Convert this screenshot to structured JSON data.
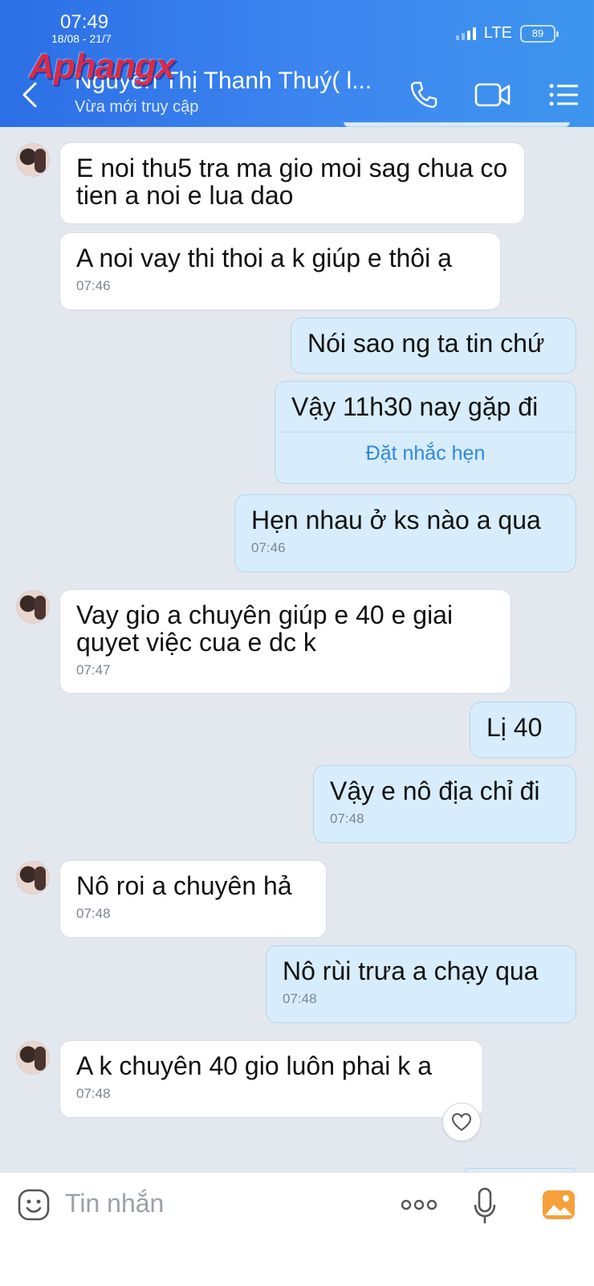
{
  "status_bar": {
    "time": "07:49",
    "date": "18/08 - 21/7",
    "network": "LTE",
    "battery": "89"
  },
  "header": {
    "watermark": "Aphangx",
    "contact_name": "Nguyễn Thị Thanh Thuý( l...",
    "contact_status": "Vừa mới truy cập"
  },
  "messages": [
    {
      "side": "in",
      "text": "E noi thu5 tra ma gio moi sag chua co tien a noi e lua dao",
      "time": ""
    },
    {
      "side": "in",
      "text": "A noi vay thi thoi a k giúp e thôi ạ",
      "time": "07:46"
    },
    {
      "side": "out",
      "text": "Nói sao ng ta tin chứ",
      "time": ""
    },
    {
      "side": "out",
      "text": "Vậy 11h30 nay gặp đi",
      "time": "",
      "action": "Đặt nhắc hẹn"
    },
    {
      "side": "out",
      "text": "Hẹn nhau ở ks nào a qua",
      "time": "07:46"
    },
    {
      "side": "in",
      "text": "Vay gio a chuyên giúp e 40 e giai quyet việc cua e dc k",
      "time": "07:47"
    },
    {
      "side": "out",
      "text": "Lị 40",
      "time": ""
    },
    {
      "side": "out",
      "text": "Vậy e nô địa chỉ đi",
      "time": "07:48"
    },
    {
      "side": "in",
      "text": "Nô roi a chuyên hả",
      "time": "07:48"
    },
    {
      "side": "out",
      "text": "Nô rùi trưa a chạy qua",
      "time": "07:48"
    },
    {
      "side": "in",
      "text": "A k chuyên 40  gio luôn phai k a",
      "time": "07:48"
    }
  ],
  "input_bar": {
    "placeholder": "Tin nhắn"
  },
  "icons": {
    "back": "chevron-left-icon",
    "call": "phone-icon",
    "video": "video-camera-icon",
    "menu": "list-menu-icon",
    "sticker": "smiley-icon",
    "more": "ellipsis-icon",
    "voice": "microphone-icon",
    "gallery": "image-icon",
    "react": "heart-icon"
  },
  "colors": {
    "header_start": "#2c6fe6",
    "header_end": "#3d95ee",
    "outgoing_bubble": "#d7edfb",
    "incoming_bubble": "#ffffff",
    "chat_bg": "#e3e8ef",
    "link": "#2f86e0",
    "gallery_icon": "#f5a03a"
  }
}
